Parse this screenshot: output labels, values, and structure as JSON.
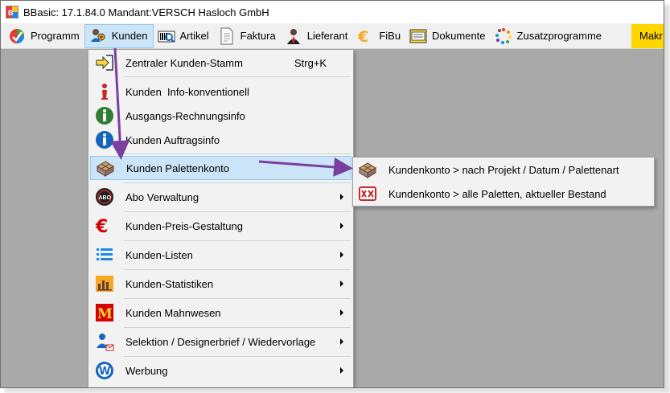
{
  "window": {
    "title": "BBasic: 17.1.84.0 Mandant:VERSCH Hasloch GmbH"
  },
  "menubar": {
    "items": [
      {
        "label": "Programm",
        "icon": "programm-icon"
      },
      {
        "label": "Kunden",
        "icon": "kunden-icon",
        "active": true
      },
      {
        "label": "Artikel",
        "icon": "artikel-icon"
      },
      {
        "label": "Faktura",
        "icon": "faktura-icon"
      },
      {
        "label": "Lieferant",
        "icon": "lieferant-icon"
      },
      {
        "label": "FiBu",
        "icon": "fibu-icon"
      },
      {
        "label": "Dokumente",
        "icon": "dokumente-icon"
      },
      {
        "label": "Zusatzprogramme",
        "icon": "zusatzprogramme-icon"
      },
      {
        "label": "Makr",
        "icon": ""
      }
    ]
  },
  "kunden_menu": {
    "items": [
      {
        "label": "Zentraler Kunden-Stamm",
        "shortcut": "Strg+K",
        "icon": "arrow-into-icon"
      },
      {
        "label": "Kunden  Info-konventionell",
        "icon": "info-red-icon"
      },
      {
        "label": "Ausgangs-Rechnungsinfo",
        "icon": "info-green-icon"
      },
      {
        "label": "Kunden Auftragsinfo",
        "icon": "info-blue-icon"
      },
      {
        "label": "Kunden Palettenkonto",
        "icon": "pallet-icon",
        "highlighted": true
      },
      {
        "label": "Abo Verwaltung",
        "icon": "abo-icon",
        "submenu": true
      },
      {
        "label": "Kunden-Preis-Gestaltung",
        "icon": "euro-icon",
        "submenu": true
      },
      {
        "label": "Kunden-Listen",
        "icon": "list-icon",
        "submenu": true
      },
      {
        "label": "Kunden-Statistiken",
        "icon": "statistics-icon",
        "submenu": true
      },
      {
        "label": "Kunden Mahnwesen",
        "icon": "mahnwesen-icon",
        "submenu": true
      },
      {
        "label": "Selektion / Designerbrief / Wiedervorlage",
        "icon": "selection-icon",
        "submenu": true
      },
      {
        "label": "Werbung",
        "icon": "werbung-icon",
        "submenu": true
      }
    ]
  },
  "palettenkonto_submenu": {
    "items": [
      {
        "label": "Kundenkonto > nach Projekt / Datum / Palettenart",
        "icon": "pallet-icon"
      },
      {
        "label": "Kundenkonto > alle Paletten, aktueller Bestand",
        "icon": "pallets-red-icon"
      }
    ]
  },
  "colors": {
    "annotation_arrow": "#7b3fa0",
    "highlight": "#cce4f7",
    "highlight_border": "#99c9ef",
    "workspace": "#a9a9a9",
    "makro_bg": "#ffd700"
  }
}
